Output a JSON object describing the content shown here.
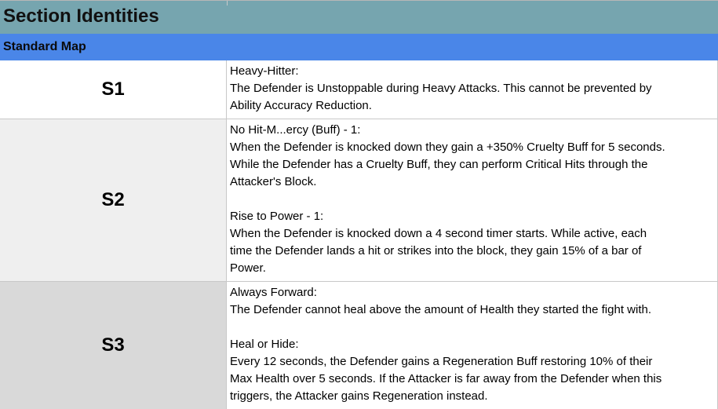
{
  "title": "Section Identities",
  "section_header": "Standard Map",
  "rows": [
    {
      "label": "S1",
      "lines": [
        "Heavy-Hitter:",
        "The Defender is Unstoppable during Heavy Attacks. This cannot be prevented by",
        "Ability Accuracy Reduction."
      ]
    },
    {
      "label": "S2",
      "lines": [
        "No Hit-M...ercy (Buff) - 1:",
        "When the Defender is knocked down they gain a +350% Cruelty Buff for 5 seconds.",
        "While the Defender has a Cruelty Buff, they can perform Critical Hits through the",
        "Attacker's Block.",
        "",
        "Rise to Power - 1:",
        "When the Defender is knocked down a 4 second timer starts. While active, each",
        "time the Defender lands a hit or strikes into the block, they gain 15% of a bar of",
        "Power."
      ]
    },
    {
      "label": "S3",
      "lines": [
        "Always Forward:",
        "The Defender cannot heal above the amount of Health they started the fight with.",
        "",
        "Heal or Hide:",
        "Every 12 seconds, the Defender gains a Regeneration Buff restoring 10% of their",
        "Max Health over 5 seconds. If the Attacker is far away from the Defender when this",
        "triggers, the Attacker gains Regeneration instead."
      ]
    }
  ]
}
